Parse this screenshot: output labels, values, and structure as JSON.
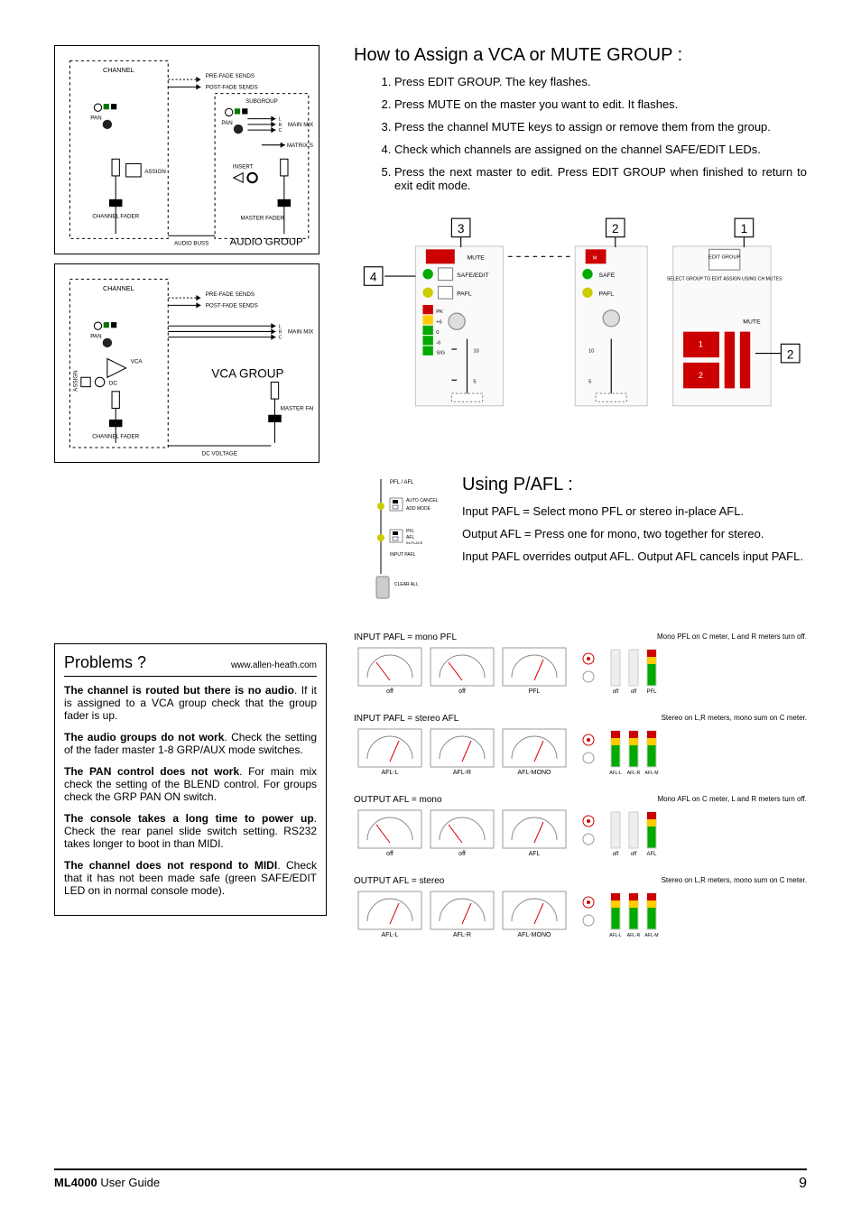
{
  "sections": {
    "vca_mute": {
      "title": "How to Assign a VCA or MUTE GROUP :",
      "steps": [
        "Press EDIT GROUP.  The key flashes.",
        "Press MUTE on the master you want to edit.  It flashes.",
        "Press the channel MUTE keys to assign or remove them from the group.",
        "Check which channels are assigned on the channel SAFE/EDIT LEDs.",
        "Press the next master to edit.  Press EDIT GROUP when finished to return to exit edit mode."
      ]
    },
    "pafl": {
      "title": "Using P/AFL :",
      "paras": [
        "Input PAFL = Select mono PFL or stereo in-place AFL.",
        "Output AFL = Press one for mono, two together for stereo.",
        "Input PAFL overrides output AFL. Output AFL cancels input PAFL."
      ]
    },
    "problems": {
      "title": "Problems ?",
      "url": "www.allen-heath.com",
      "items": [
        {
          "b": "The channel is routed but there is no audio",
          "t": ". If it is assigned to a VCA group check that the group fader is up."
        },
        {
          "b": "The audio groups do not work",
          "t": ". Check the setting of the fader master 1-8 GRP/AUX mode switches."
        },
        {
          "b": "The PAN control does not work",
          "t": ". For main mix check the setting of the BLEND control. For groups check the GRP PAN ON switch."
        },
        {
          "b": "The console takes a long time to power up",
          "t": ". Check the rear panel slide switch setting. RS232 takes longer to boot in than MIDI."
        },
        {
          "b": "The channel does not respond to MIDI",
          "t": ". Check that it has not been made safe (green SAFE/EDIT LED on in normal console mode)."
        }
      ]
    }
  },
  "diagrams": {
    "audio_group": {
      "title": "AUDIO GROUP",
      "labels": [
        "CHANNEL",
        "PRE-FADE SENDS",
        "POST-FADE SENDS",
        "SUBGROUP",
        "PAN",
        "MAIN MIX",
        "L",
        "R",
        "C",
        "MATRIX SEND",
        "INSERT",
        "ASSIGN",
        "CHANNEL FADER",
        "MASTER FADER",
        "AUDIO BUSS"
      ]
    },
    "vca_group": {
      "title": "VCA GROUP",
      "labels": [
        "CHANNEL",
        "PRE-FADE SENDS",
        "POST-FADE SENDS",
        "PAN",
        "MAIN MIX",
        "L",
        "R",
        "C",
        "VCA",
        "DC",
        "ASSIGN",
        "CHANNEL FADER",
        "MASTER FADER",
        "DC VOLTAGE"
      ]
    },
    "channel_strip": {
      "callouts": [
        "1",
        "2",
        "3",
        "4"
      ],
      "labels": [
        "MUTE",
        "SAFE/EDIT",
        "SAFE",
        "PAFL",
        "EDIT GROUP",
        "SELECT GROUP TO EDIT ASSIGN USING CH MUTES",
        "PK",
        "+6",
        "0",
        "-6",
        "SIG",
        "10",
        "5",
        "1",
        "2"
      ]
    },
    "pafl_buttons": {
      "labels": [
        "PFL / AFL",
        "AUTO CANCEL",
        "ADD MODE",
        "PFL",
        "AFL",
        "IN-PLACE",
        "INPUT PAFL",
        "CLEAR ALL"
      ]
    },
    "meters": [
      {
        "title_l": "INPUT PAFL  =  mono PFL",
        "title_r": "Mono PFL on C meter,  L and R meters turn off.",
        "knobs": [
          "off",
          "off",
          "PFL"
        ],
        "meters": [
          "off",
          "off",
          "PFL"
        ]
      },
      {
        "title_l": "INPUT PAFL  =  stereo AFL",
        "title_r": "Stereo on L,R meters, mono sum on C meter.",
        "knobs": [
          "AFL-L",
          "AFL-R",
          "AFL-MONO"
        ],
        "meters": [
          "AFL-L",
          "AFL-R",
          "AFL-M"
        ]
      },
      {
        "title_l": "OUTPUT AFL  =  mono",
        "title_r": "Mono AFL on C meter,  L and R meters turn off.",
        "knobs": [
          "off",
          "off",
          "AFL"
        ],
        "meters": [
          "off",
          "off",
          "AFL"
        ]
      },
      {
        "title_l": "OUTPUT AFL  =  stereo",
        "title_r": "Stereo on L,R meters, mono sum on C meter.",
        "knobs": [
          "AFL-L",
          "AFL-R",
          "AFL-MONO"
        ],
        "meters": [
          "AFL-L",
          "AFL-R",
          "AFL-M"
        ]
      }
    ]
  },
  "footer": {
    "product": "ML4000",
    "guide": " User Guide",
    "page": "9"
  }
}
